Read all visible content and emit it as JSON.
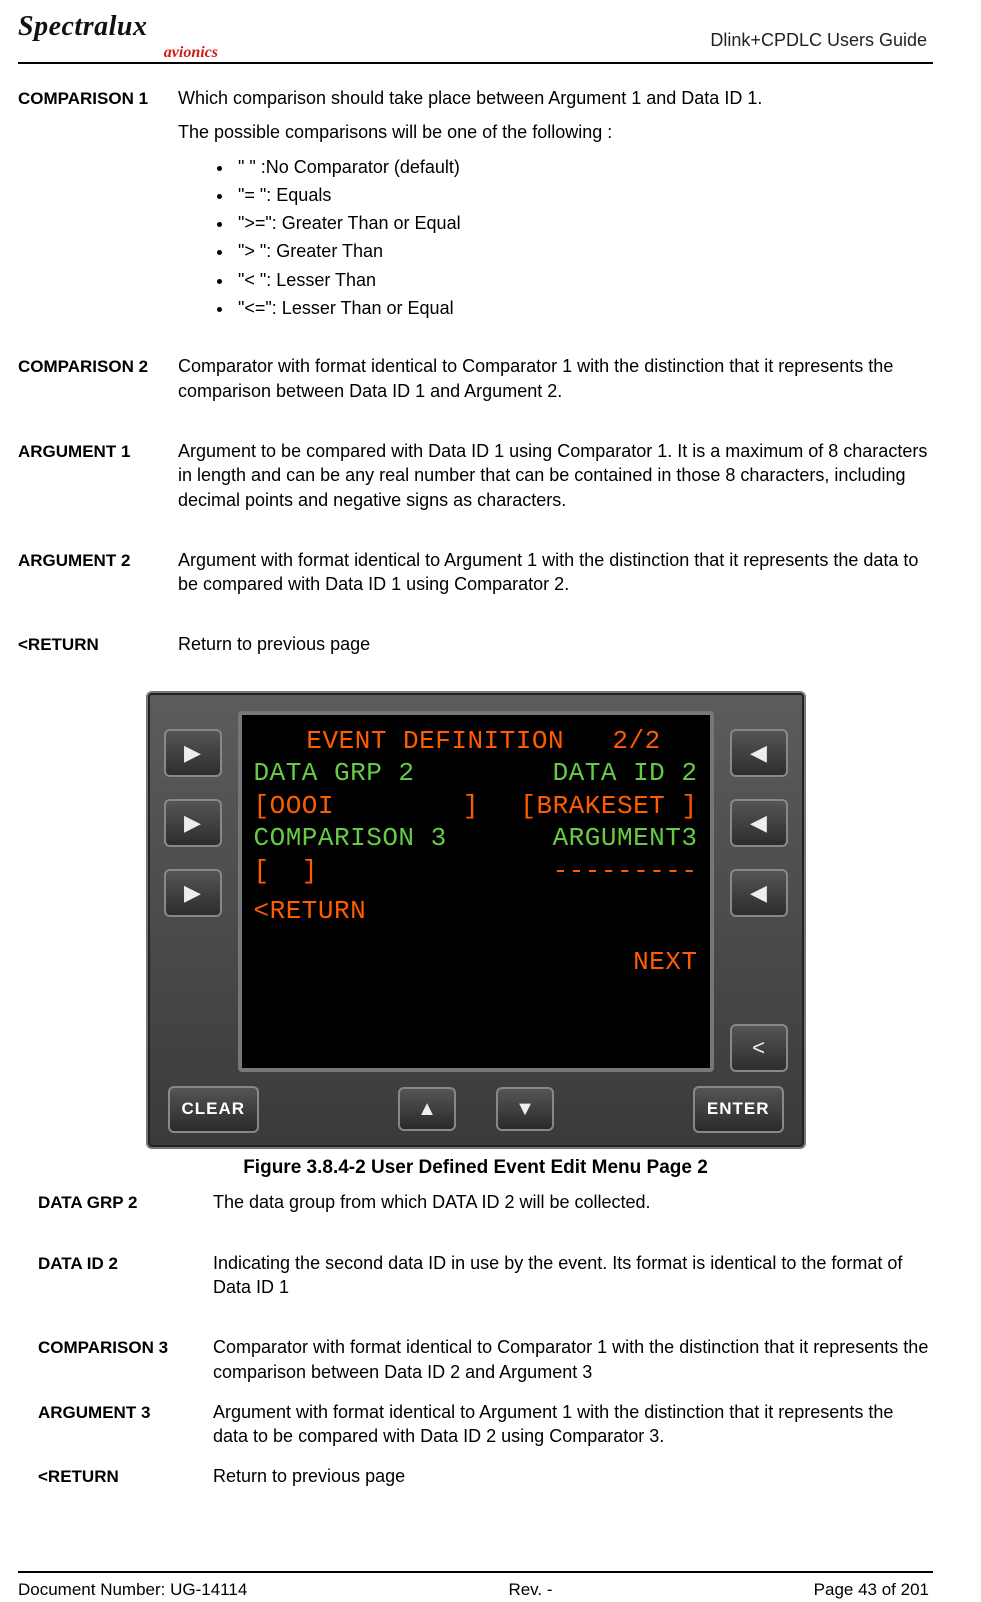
{
  "header": {
    "logo_main": "Spectralux",
    "logo_sub": "avionics",
    "guide_title": "Dlink+CPDLC Users Guide"
  },
  "section1": {
    "comp1_term": "COMPARISON 1",
    "comp1_para1": "Which comparison should take place between Argument 1 and Data ID 1.",
    "comp1_para2": "The possible comparisons will be one of the following :",
    "comp1_items": [
      "\"  \" :No Comparator (default)",
      "\"= \": Equals",
      "\">=\": Greater Than or Equal",
      "\"> \": Greater Than",
      "\"< \": Lesser Than",
      "\"<=\": Lesser Than or Equal"
    ],
    "comp2_term": "COMPARISON 2",
    "comp2_body": "Comparator with format identical to Comparator 1 with the distinction that it represents the comparison between Data ID 1 and Argument 2.",
    "arg1_term": "ARGUMENT 1",
    "arg1_body": "Argument to be compared with Data ID 1 using Comparator 1. It is a maximum of 8 characters in length and can be any real number that can be contained in those 8 characters, including decimal points and negative signs as characters.",
    "arg2_term": "ARGUMENT 2",
    "arg2_body": "Argument with format identical to Argument 1 with the distinction that it represents the data to be compared with Data ID 1 using Comparator 2.",
    "return_term": "<RETURN",
    "return_body": "Return to previous page"
  },
  "figure": {
    "caption": "Figure 3.8.4-2 User Defined Event Edit Menu Page 2",
    "screen": {
      "title": " EVENT DEFINITION   2/2",
      "r2_left": "DATA GRP 2",
      "r2_right": "DATA ID 2",
      "r3_left": "[OOOI        ]",
      "r3_right": "[BRAKESET ]",
      "r4_left": "COMPARISON 3",
      "r4_right": "ARGUMENT3",
      "r5_left": "[  ]",
      "r5_right": "---------",
      "return": "<RETURN",
      "next": "NEXT"
    },
    "clear": "CLEAR",
    "enter": "ENTER"
  },
  "section2": {
    "dgrp_term": "DATA GRP 2",
    "dgrp_body": "The data group from which DATA ID 2 will be collected.",
    "did_term": "DATA ID 2",
    "did_body": "Indicating the second data ID in use by the event. Its format is identical to the format of Data ID 1",
    "comp3_term": "COMPARISON 3",
    "comp3_body": "Comparator with format identical to Comparator 1 with the distinction that it represents the comparison between Data ID 2 and Argument 3",
    "arg3_term": "ARGUMENT 3",
    "arg3_body": "Argument with format identical to Argument 1 with the distinction that it represents the data to be compared with Data ID 2 using Comparator 3.",
    "return_term": "<RETURN",
    "return_body": "Return to previous page"
  },
  "footer": {
    "doc": "Document Number:  UG-14114",
    "rev": "Rev. -",
    "page": "Page 43 of 201"
  }
}
